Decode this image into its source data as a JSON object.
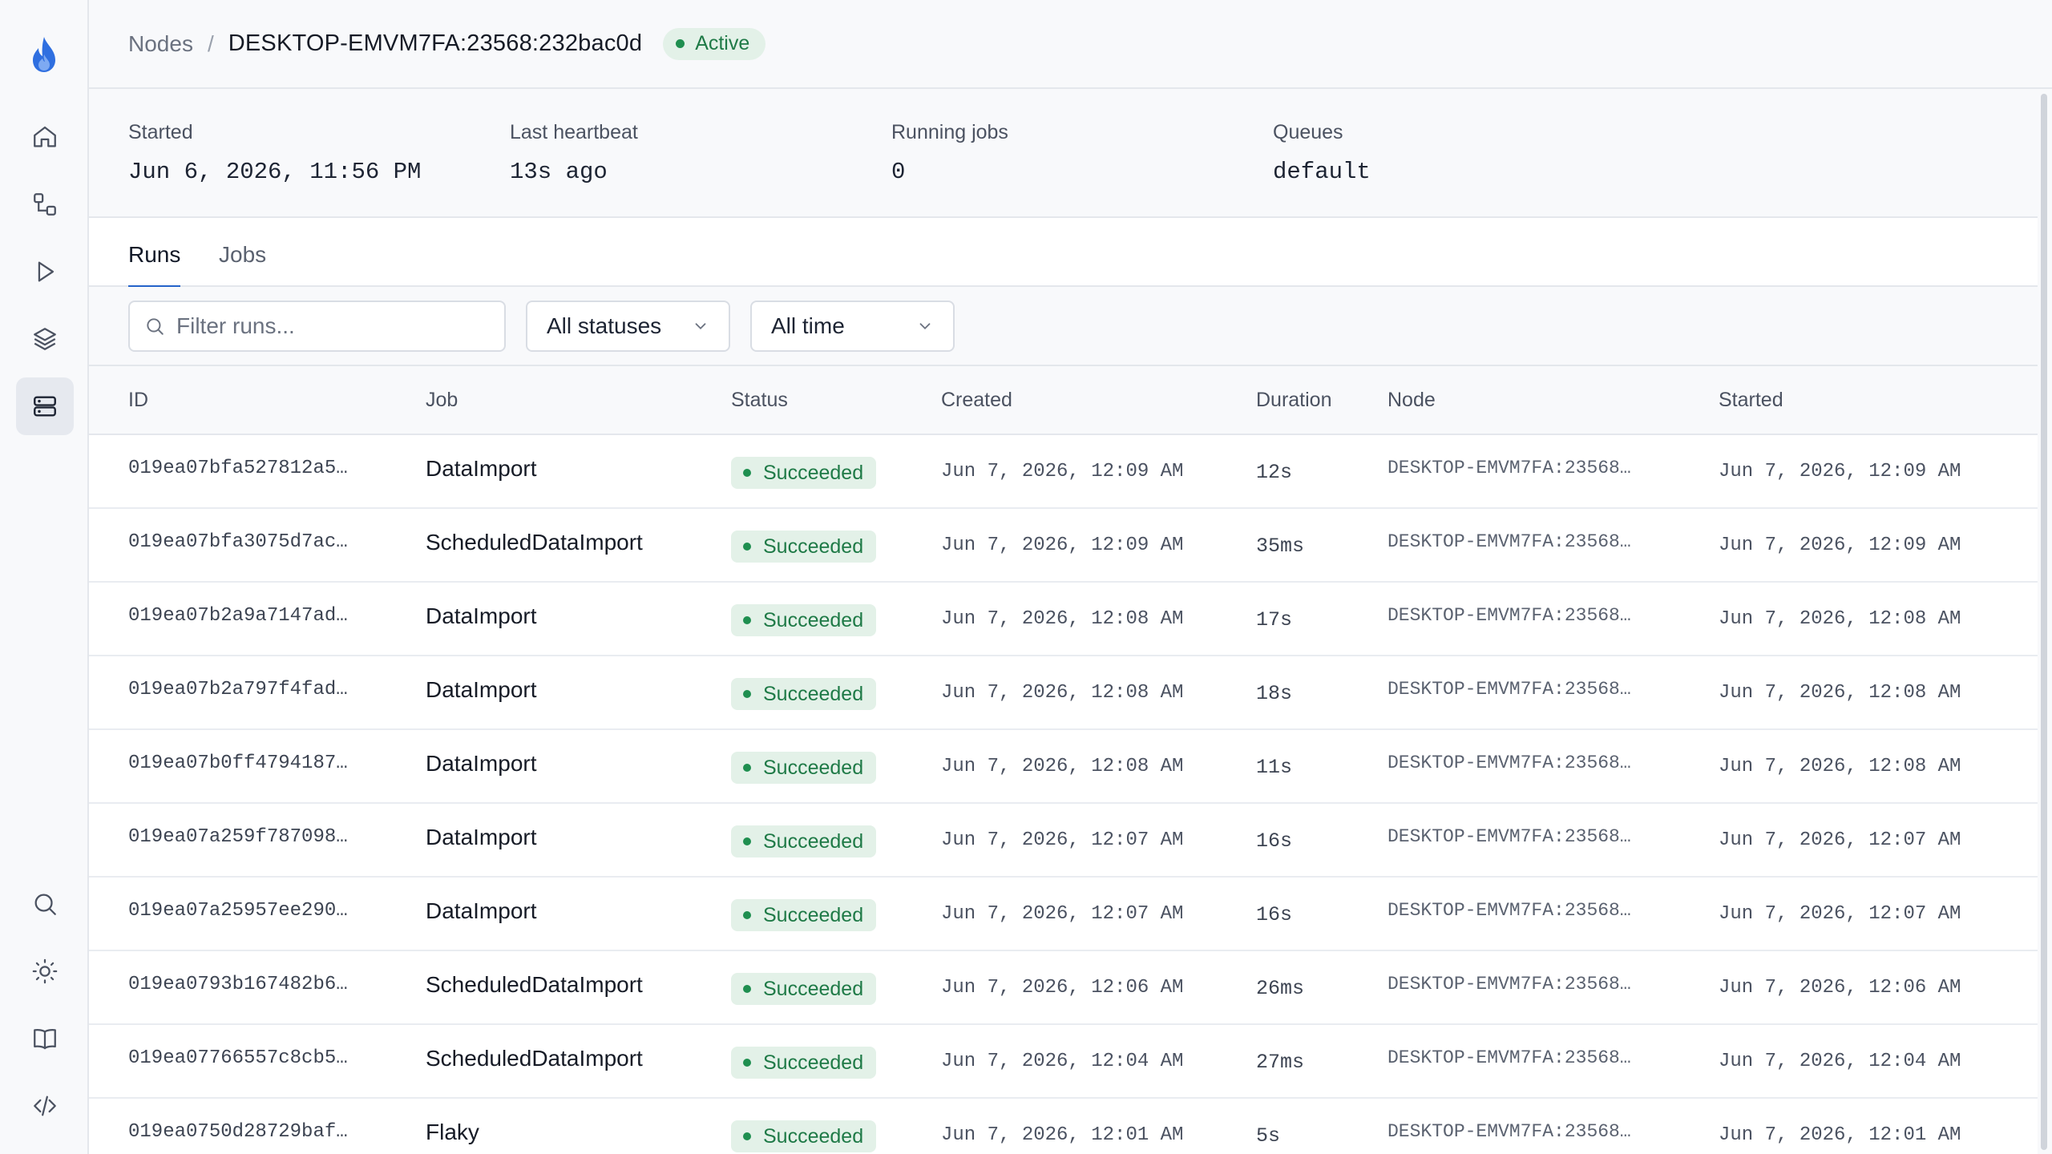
{
  "sidebar": {
    "logo": "flame-logo",
    "nav": [
      {
        "name": "home-icon",
        "active": false
      },
      {
        "name": "workflow-icon",
        "active": false
      },
      {
        "name": "play-icon",
        "active": false
      },
      {
        "name": "layers-icon",
        "active": false
      },
      {
        "name": "server-icon",
        "active": true
      }
    ],
    "bottom": [
      "search-icon",
      "sun-icon",
      "book-icon",
      "code-icon"
    ]
  },
  "header": {
    "breadcrumb_root": "Nodes",
    "separator": "/",
    "current": "DESKTOP-EMVM7FA:23568:232bac0d",
    "status": "Active",
    "status_color": "#1f8f50"
  },
  "stats": [
    {
      "label": "Started",
      "value": "Jun 6, 2026, 11:56 PM"
    },
    {
      "label": "Last heartbeat",
      "value": "13s ago"
    },
    {
      "label": "Running jobs",
      "value": "0"
    },
    {
      "label": "Queues",
      "value": "default"
    }
  ],
  "tabs": [
    {
      "label": "Runs",
      "active": true
    },
    {
      "label": "Jobs",
      "active": false
    }
  ],
  "filters": {
    "search_placeholder": "Filter runs...",
    "status_select": "All statuses",
    "time_select": "All time"
  },
  "table": {
    "columns": [
      "ID",
      "Job",
      "Status",
      "Created",
      "Duration",
      "Node",
      "Started"
    ],
    "rows": [
      {
        "id": "019ea07bfa527812a5…",
        "job": "DataImport",
        "status": "Succeeded",
        "created": "Jun 7, 2026, 12:09 AM",
        "duration": "12s",
        "node": "DESKTOP-EMVM7FA:23568…",
        "started": "Jun 7, 2026, 12:09 AM"
      },
      {
        "id": "019ea07bfa3075d7ac…",
        "job": "ScheduledDataImport",
        "status": "Succeeded",
        "created": "Jun 7, 2026, 12:09 AM",
        "duration": "35ms",
        "node": "DESKTOP-EMVM7FA:23568…",
        "started": "Jun 7, 2026, 12:09 AM"
      },
      {
        "id": "019ea07b2a9a7147ad…",
        "job": "DataImport",
        "status": "Succeeded",
        "created": "Jun 7, 2026, 12:08 AM",
        "duration": "17s",
        "node": "DESKTOP-EMVM7FA:23568…",
        "started": "Jun 7, 2026, 12:08 AM"
      },
      {
        "id": "019ea07b2a797f4fad…",
        "job": "DataImport",
        "status": "Succeeded",
        "created": "Jun 7, 2026, 12:08 AM",
        "duration": "18s",
        "node": "DESKTOP-EMVM7FA:23568…",
        "started": "Jun 7, 2026, 12:08 AM"
      },
      {
        "id": "019ea07b0ff4794187…",
        "job": "DataImport",
        "status": "Succeeded",
        "created": "Jun 7, 2026, 12:08 AM",
        "duration": "11s",
        "node": "DESKTOP-EMVM7FA:23568…",
        "started": "Jun 7, 2026, 12:08 AM"
      },
      {
        "id": "019ea07a259f787098…",
        "job": "DataImport",
        "status": "Succeeded",
        "created": "Jun 7, 2026, 12:07 AM",
        "duration": "16s",
        "node": "DESKTOP-EMVM7FA:23568…",
        "started": "Jun 7, 2026, 12:07 AM"
      },
      {
        "id": "019ea07a25957ee290…",
        "job": "DataImport",
        "status": "Succeeded",
        "created": "Jun 7, 2026, 12:07 AM",
        "duration": "16s",
        "node": "DESKTOP-EMVM7FA:23568…",
        "started": "Jun 7, 2026, 12:07 AM"
      },
      {
        "id": "019ea0793b167482b6…",
        "job": "ScheduledDataImport",
        "status": "Succeeded",
        "created": "Jun 7, 2026, 12:06 AM",
        "duration": "26ms",
        "node": "DESKTOP-EMVM7FA:23568…",
        "started": "Jun 7, 2026, 12:06 AM"
      },
      {
        "id": "019ea07766557c8cb5…",
        "job": "ScheduledDataImport",
        "status": "Succeeded",
        "created": "Jun 7, 2026, 12:04 AM",
        "duration": "27ms",
        "node": "DESKTOP-EMVM7FA:23568…",
        "started": "Jun 7, 2026, 12:04 AM"
      },
      {
        "id": "019ea0750d28729baf…",
        "job": "Flaky",
        "status": "Succeeded",
        "created": "Jun 7, 2026, 12:01 AM",
        "duration": "5s",
        "node": "DESKTOP-EMVM7FA:23568…",
        "started": "Jun 7, 2026, 12:01 AM"
      }
    ]
  },
  "colors": {
    "accent": "#2563c9",
    "success_bg": "#e3f1e8",
    "success_text": "#1f7a47",
    "logo_blue": "#2f6fe0"
  }
}
